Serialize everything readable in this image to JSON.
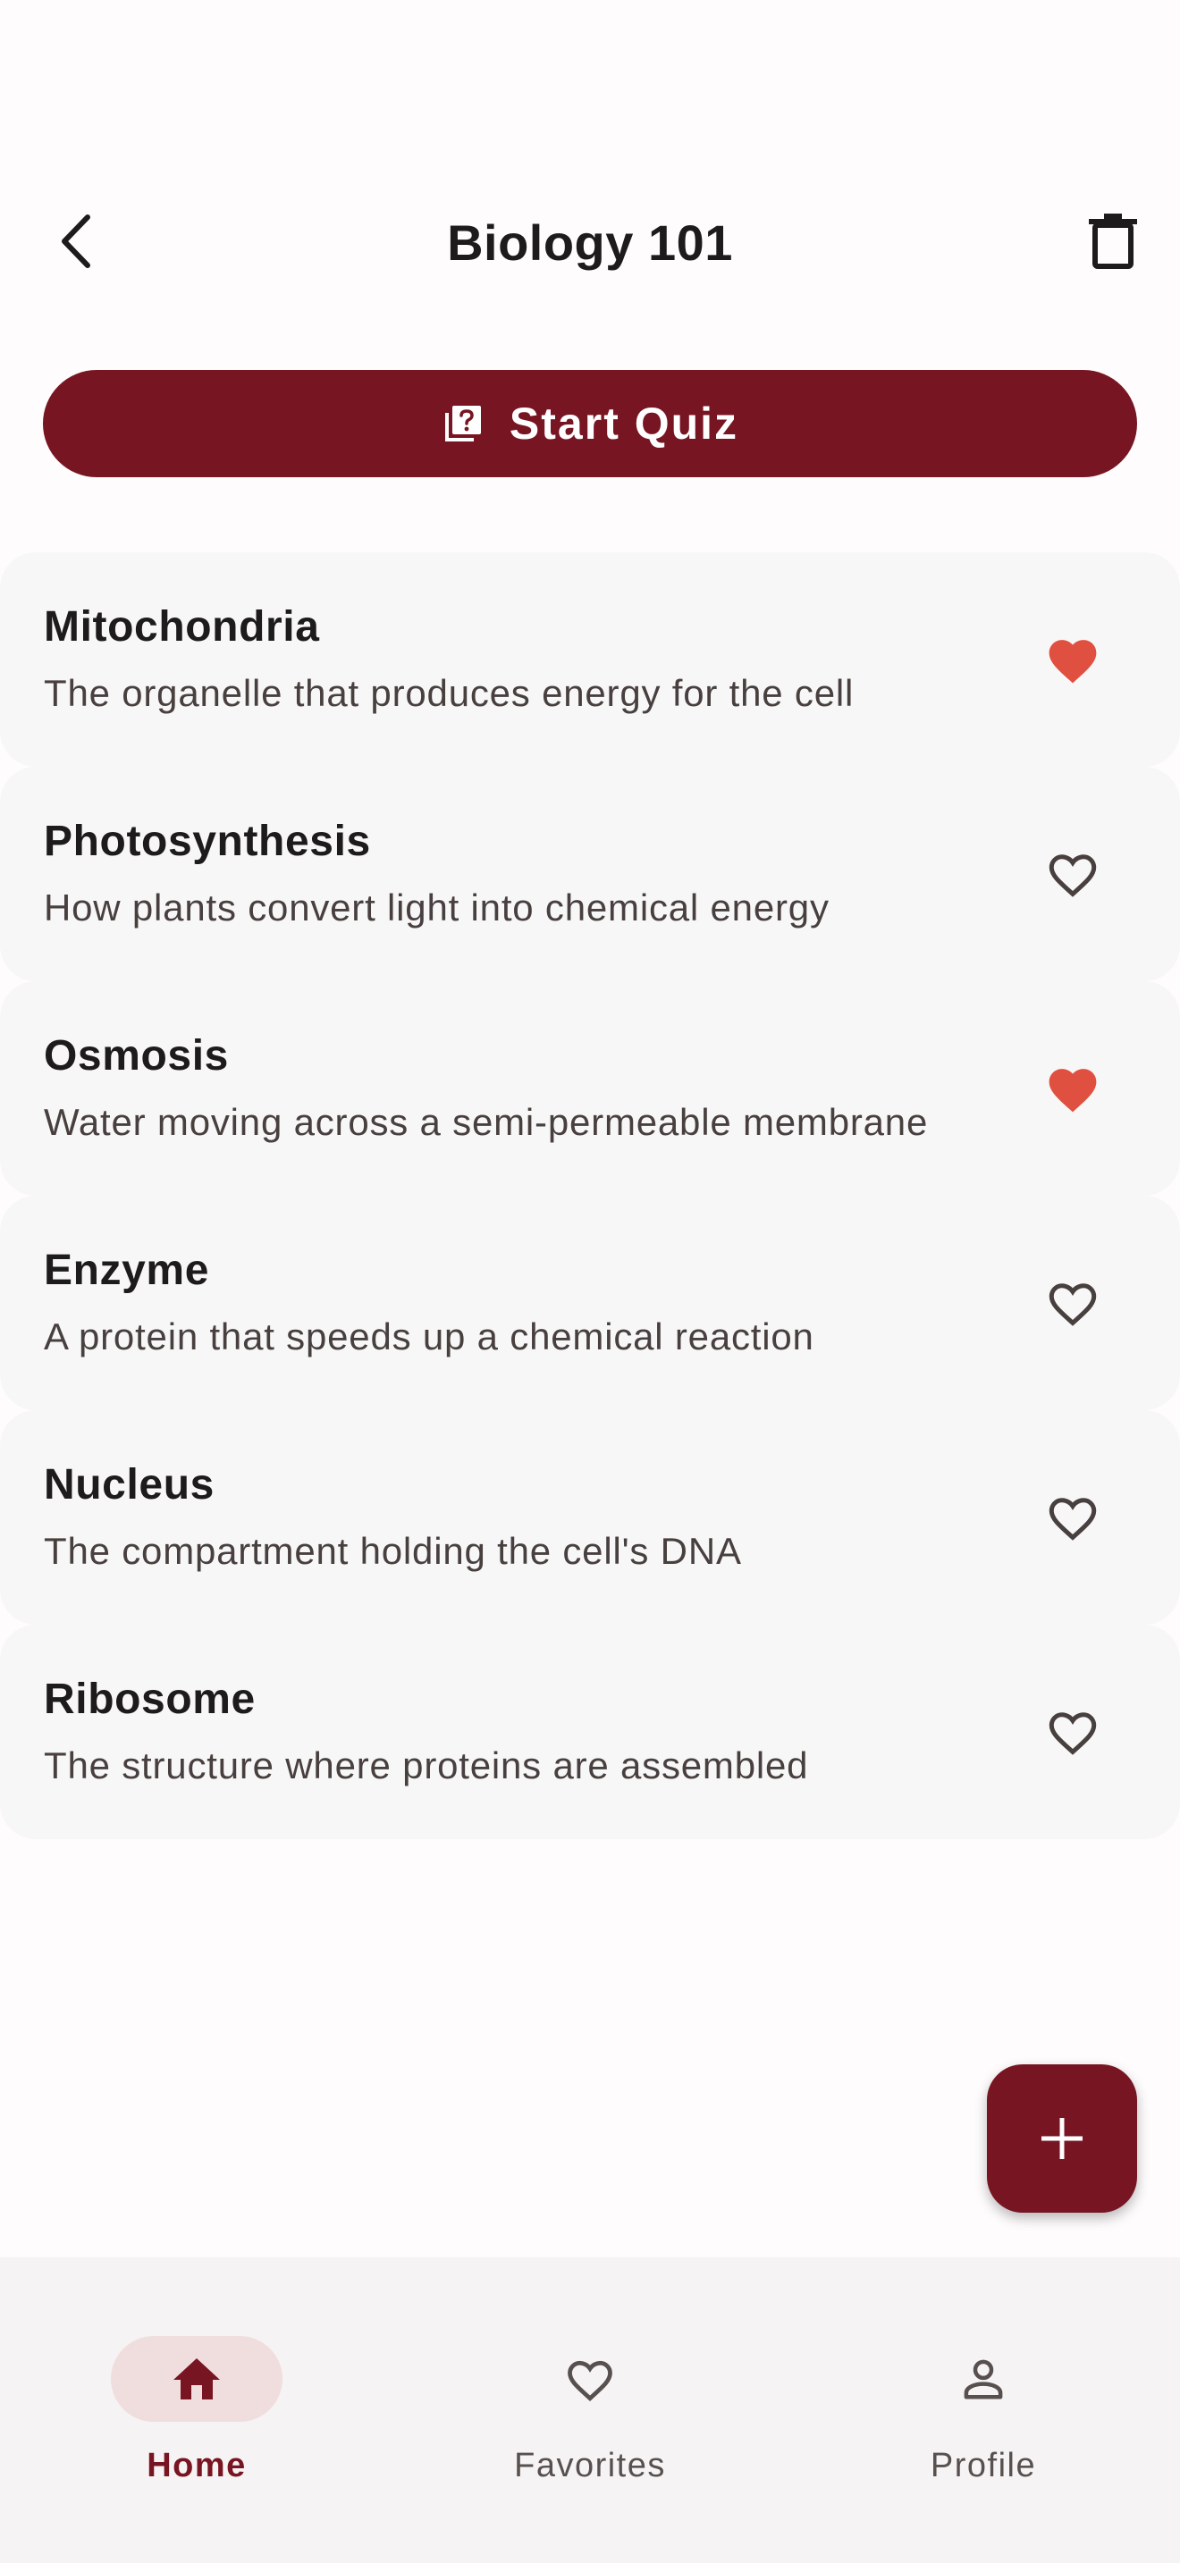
{
  "header": {
    "title": "Biology 101",
    "back_icon": "chevron-left-icon",
    "delete_icon": "trash-icon"
  },
  "start_quiz": {
    "label": "Start Quiz",
    "icon": "quiz-icon"
  },
  "cards": [
    {
      "title": "Mitochondria",
      "description": "The organelle that produces energy for the cell",
      "favorite": true
    },
    {
      "title": "Photosynthesis",
      "description": "How plants convert light into chemical energy",
      "favorite": false
    },
    {
      "title": "Osmosis",
      "description": "Water moving across a semi-permeable membrane",
      "favorite": true
    },
    {
      "title": "Enzyme",
      "description": "A protein that speeds up a chemical reaction",
      "favorite": false
    },
    {
      "title": "Nucleus",
      "description": "The compartment holding the cell's DNA",
      "favorite": false
    },
    {
      "title": "Ribosome",
      "description": "The structure where proteins are assembled",
      "favorite": false
    }
  ],
  "fab": {
    "icon": "plus-icon"
  },
  "bottom_nav": {
    "items": [
      {
        "label": "Home",
        "icon": "home-icon",
        "active": true
      },
      {
        "label": "Favorites",
        "icon": "heart-icon",
        "active": false
      },
      {
        "label": "Profile",
        "icon": "person-icon",
        "active": false
      }
    ]
  },
  "colors": {
    "primary": "#771522",
    "favorite": "#e05040",
    "nav_active_pill": "#f0dede",
    "card_background": "#f8f7f7"
  }
}
